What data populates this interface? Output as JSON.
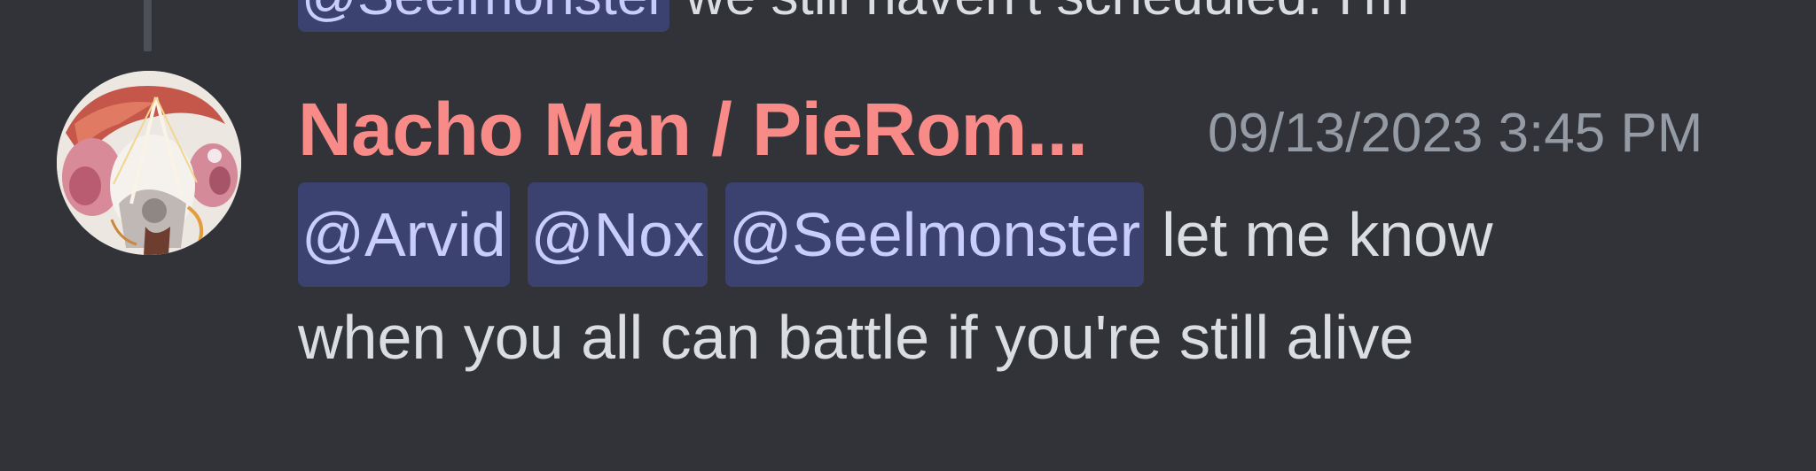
{
  "colors": {
    "background": "#313338",
    "username": "#f88a88",
    "timestamp": "#949ba4",
    "text": "#dbdee1",
    "mention_bg": "#3c4270",
    "mention_text": "#c9cdfb"
  },
  "previous_message": {
    "mention": "@Seelmonster",
    "text": "we still haven't scheduled. I'm"
  },
  "message": {
    "avatar_icon": "user-avatar",
    "username": "Nacho Man / PieRom...",
    "timestamp": "09/13/2023 3:45 PM",
    "mentions": [
      "@Arvid",
      "@Nox",
      "@Seelmonster"
    ],
    "text_line1": "let me know",
    "text_line2": "when you all can battle if you're still alive"
  }
}
